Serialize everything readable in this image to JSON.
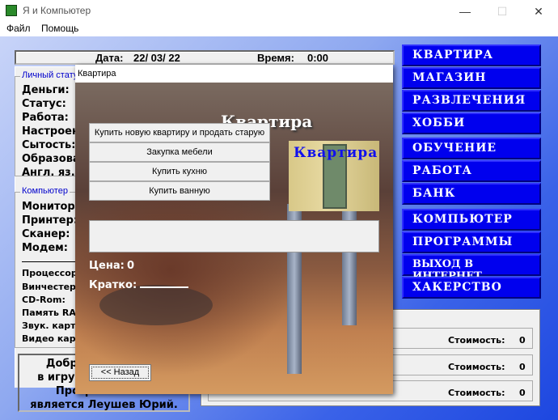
{
  "window": {
    "title": "Я и Компьютер",
    "minimize": "—",
    "maximize": "☐",
    "close": "✕"
  },
  "menu": [
    "Файл",
    "Помощь"
  ],
  "header": {
    "date_label": "Дата:",
    "date": "22/ 03/ 22",
    "time_label": "Время:",
    "time": "0:00"
  },
  "personal": {
    "title": "Личный статус",
    "items": [
      "Деньги:",
      "Статус:",
      "Работа:",
      "Настроение:",
      "Сытость:",
      "Образование:",
      "Англ. яз.:"
    ]
  },
  "computer": {
    "title": "Компьютер",
    "items": [
      "Монитор:",
      "Принтер:",
      "Сканер:",
      "Модем:"
    ],
    "parts": [
      "Процессор:",
      "Винчестер:",
      "CD-Rom:",
      "Память RAM:",
      "Звук. карта:",
      "Видео карта:"
    ]
  },
  "welcome": [
    "Добро пожаловать",
    "в игру Я и Компьютер",
    "Программистом",
    "является Леушев Юрий."
  ],
  "nav": [
    "КВАРТИРА",
    "МАГАЗИН",
    "РАЗВЛЕЧЕНИЯ",
    "ХОББИ",
    "ОБУЧЕНИЕ",
    "РАБОТА",
    "БАНК",
    "КОМПЬЮТЕР",
    "ПРОГРАММЫ",
    "ВЫХОД В ИНТЕРНЕТ",
    "ХАКЕРСТВО"
  ],
  "costs": [
    {
      "label": "Стоимость:",
      "value": "0"
    },
    {
      "label": "Стоимость:",
      "value": "0"
    },
    {
      "label": "Стоимость:",
      "value": "0"
    }
  ],
  "dialog": {
    "title": "Квартира",
    "heading": "Квартира",
    "thumb_title": "Квартира",
    "options": [
      "Купить новую квартиру и продать старую",
      "Закупка мебели",
      "Купить кухню",
      "Купить ванную"
    ],
    "price_label": "Цена:",
    "price": "0",
    "brief_label": "Кратко:",
    "back": "<< Назад"
  }
}
